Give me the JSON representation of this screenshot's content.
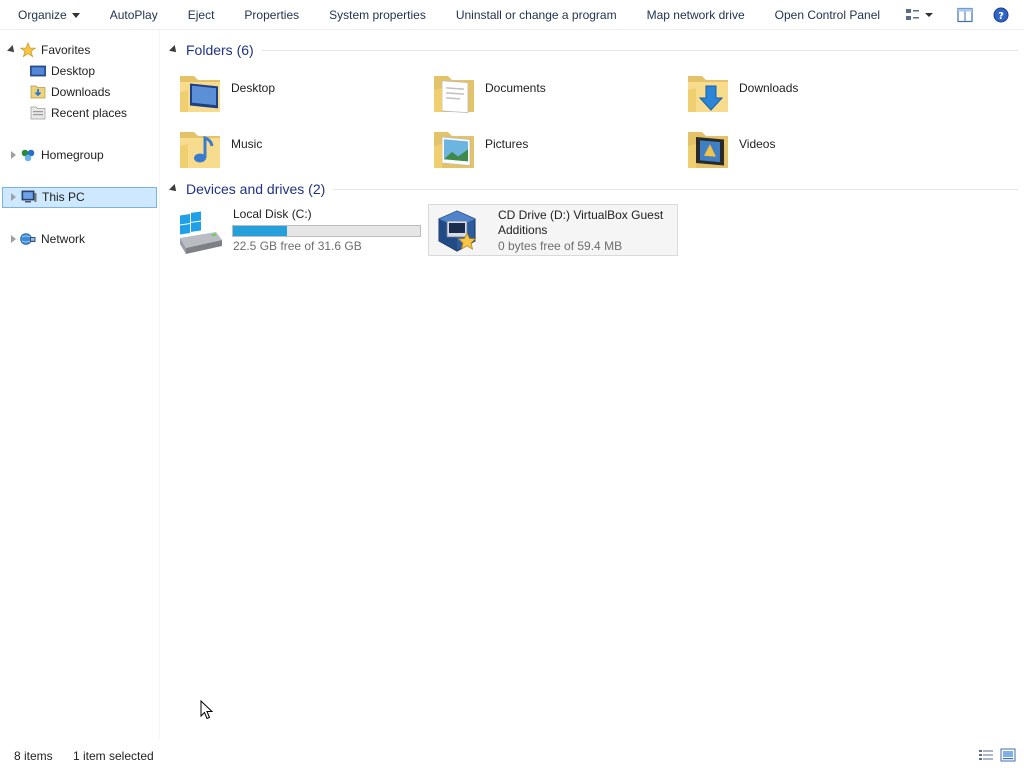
{
  "toolbar": {
    "items": [
      {
        "label": "Organize"
      },
      {
        "label": "AutoPlay"
      },
      {
        "label": "Eject"
      },
      {
        "label": "Properties"
      },
      {
        "label": "System properties"
      },
      {
        "label": "Uninstall or change a program"
      },
      {
        "label": "Map network drive"
      },
      {
        "label": "Open Control Panel"
      }
    ],
    "right_icons": [
      "change-view-icon",
      "preview-pane-icon",
      "help-icon"
    ]
  },
  "nav": {
    "favorites": {
      "label": "Favorites",
      "items": [
        {
          "label": "Desktop"
        },
        {
          "label": "Downloads"
        },
        {
          "label": "Recent places"
        }
      ]
    },
    "homegroup": {
      "label": "Homegroup"
    },
    "this_pc": {
      "label": "This PC"
    },
    "network": {
      "label": "Network"
    }
  },
  "groups": {
    "folders": {
      "title": "Folders (6)",
      "items": [
        {
          "label": "Desktop",
          "icon": "desktop-folder-icon"
        },
        {
          "label": "Documents",
          "icon": "documents-folder-icon"
        },
        {
          "label": "Downloads",
          "icon": "downloads-folder-icon"
        },
        {
          "label": "Music",
          "icon": "music-folder-icon"
        },
        {
          "label": "Pictures",
          "icon": "pictures-folder-icon"
        },
        {
          "label": "Videos",
          "icon": "videos-folder-icon"
        }
      ]
    },
    "drives": {
      "title": "Devices and drives (2)",
      "items": [
        {
          "name": "Local Disk (C:)",
          "free": "22.5 GB free of 31.6 GB",
          "used_fraction": 0.29,
          "icon": "hard-drive-icon"
        },
        {
          "name": "CD Drive (D:) VirtualBox Guest Additions",
          "free": "0 bytes free of 59.4 MB",
          "icon": "virtualbox-cd-icon"
        }
      ]
    }
  },
  "status": {
    "items_count": "8 items",
    "selection": "1 item selected"
  },
  "colors": {
    "accent": "#26a0da",
    "selection_bg": "#cde8ff",
    "selection_border": "#7ab3e6",
    "group_title": "#1e3287"
  }
}
